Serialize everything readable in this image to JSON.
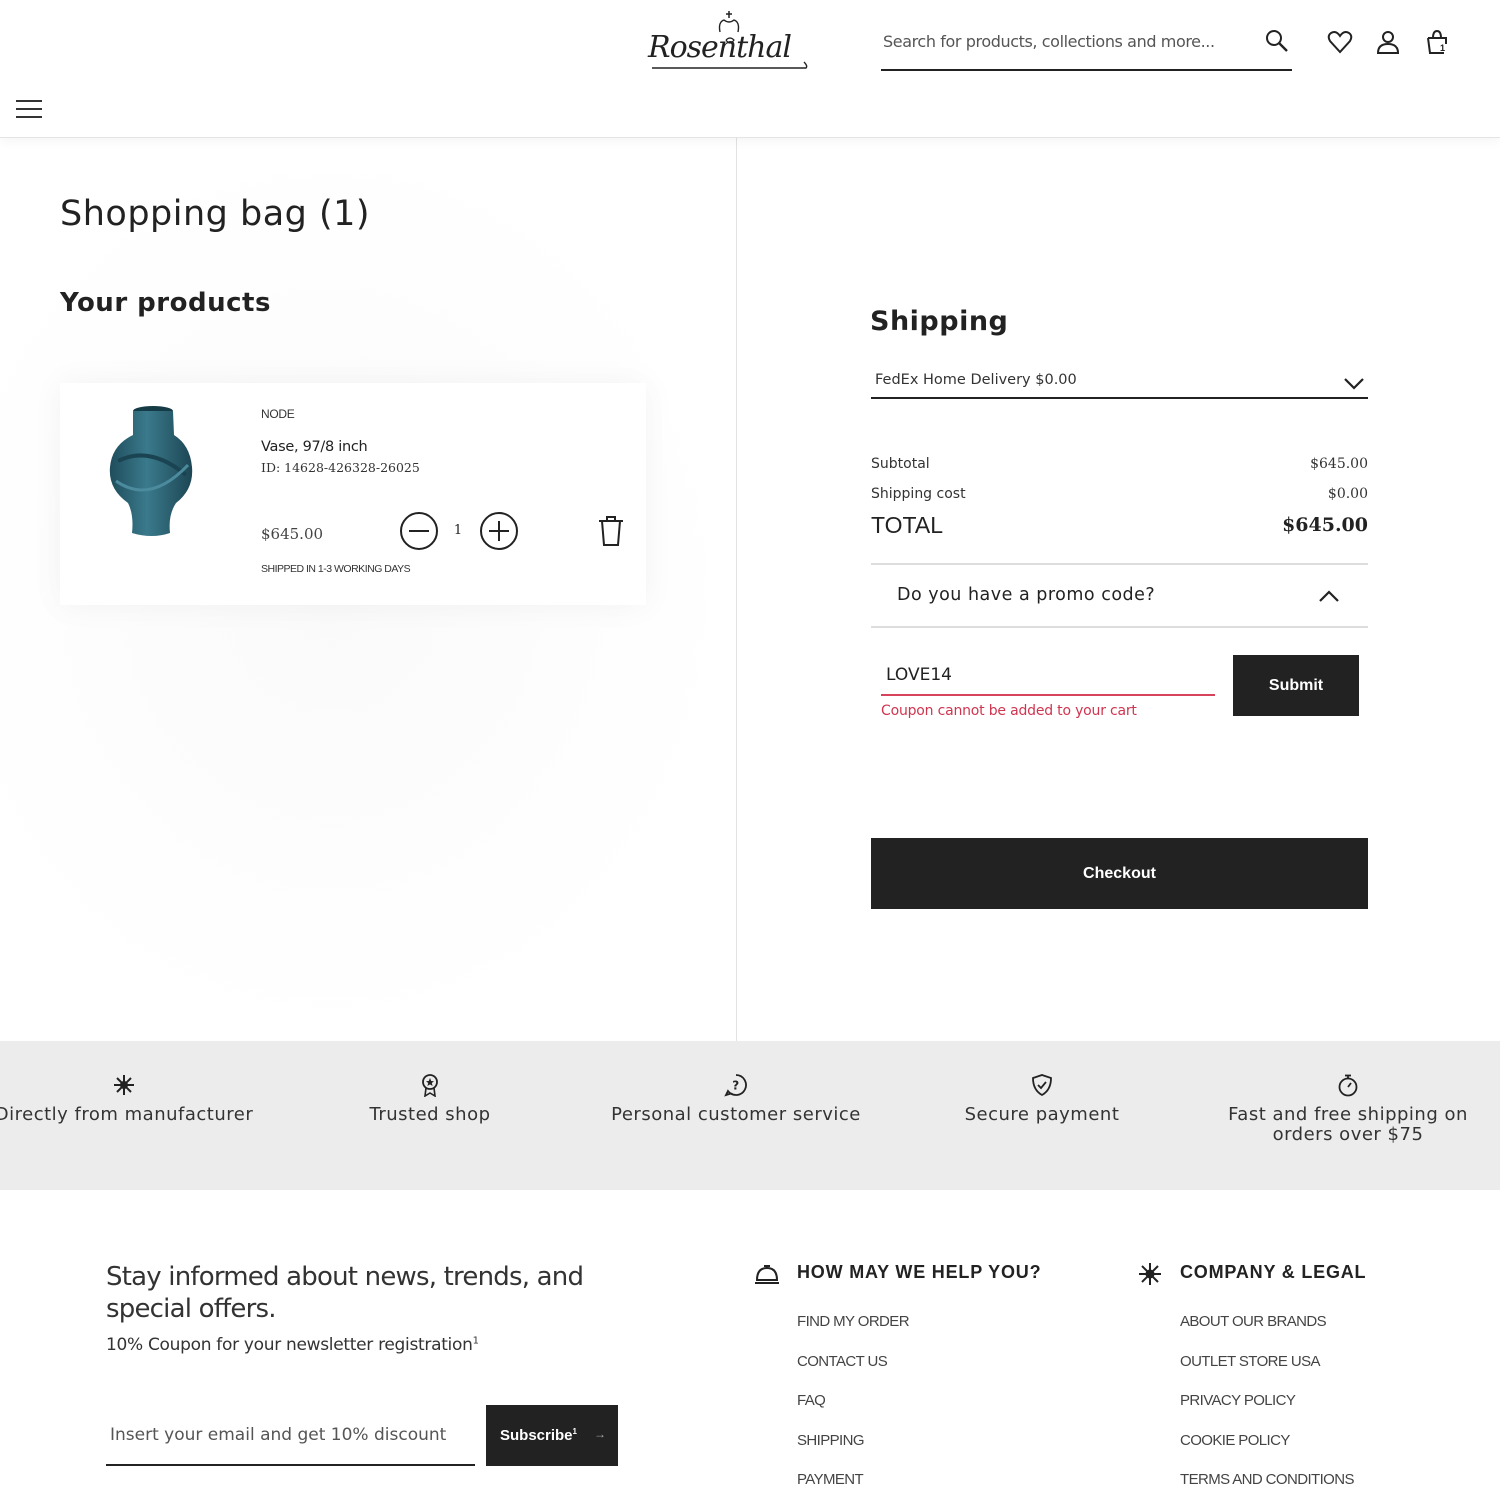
{
  "header": {
    "logo_text": "Rosenthal",
    "search_placeholder": "Search for products, collections and more...",
    "bag_count": "1"
  },
  "cart": {
    "title": "Shopping bag (1)",
    "products_heading": "Your products",
    "item": {
      "brand": "NODE",
      "name": "Vase, 97/8 inch",
      "id": "ID: 14628-426328-26025",
      "price": "$645.00",
      "quantity": "1",
      "shipping_note": "SHIPPED IN 1-3 WORKING DAYS",
      "image_color": "#2e6577"
    }
  },
  "summary": {
    "shipping_heading": "Shipping",
    "shipping_method": "FedEx Home Delivery $0.00",
    "subtotal_label": "Subtotal",
    "subtotal_value": "$645.00",
    "shipping_cost_label": "Shipping cost",
    "shipping_cost_value": "$0.00",
    "total_label": "TOTAL",
    "total_value": "$645.00",
    "promo_question": "Do you have a promo code?",
    "promo_value": "LOVE14",
    "promo_error": "Coupon cannot be added to your cart",
    "submit_label": "Submit",
    "checkout_label": "Checkout",
    "error_color": "#d0354f"
  },
  "trust": [
    {
      "icon": "star-burst-icon",
      "label": "Directly from manufacturer"
    },
    {
      "icon": "award-icon",
      "label": "Trusted shop"
    },
    {
      "icon": "question-chat-icon",
      "label": "Personal customer service"
    },
    {
      "icon": "shield-check-icon",
      "label": "Secure payment"
    },
    {
      "icon": "stopwatch-icon",
      "label": "Fast and free shipping on orders over $75"
    }
  ],
  "footer": {
    "newsletter_title": "Stay informed about news, trends, and special offers.",
    "newsletter_sub": "10% Coupon for your newsletter registration",
    "newsletter_sup": "1",
    "email_placeholder": "Insert your email and get 10% discount",
    "subscribe_label": "Subscribe",
    "subscribe_sup": "1",
    "help_heading": "HOW MAY WE HELP YOU?",
    "help_links": [
      "FIND MY ORDER",
      "CONTACT US",
      "FAQ",
      "SHIPPING",
      "PAYMENT"
    ],
    "company_heading": "COMPANY & LEGAL",
    "company_links": [
      "ABOUT OUR BRANDS",
      "OUTLET STORE USA",
      "PRIVACY POLICY",
      "COOKIE POLICY",
      "TERMS AND CONDITIONS"
    ]
  }
}
